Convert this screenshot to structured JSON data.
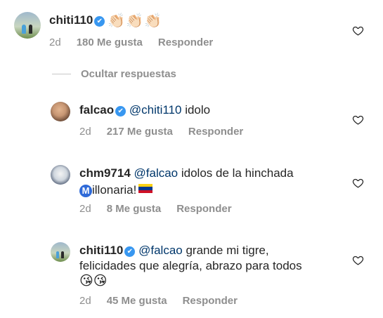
{
  "comments": [
    {
      "username": "chiti110",
      "text": "👏🏻👏🏻👏🏻",
      "age": "2d",
      "likes": "180 Me gusta",
      "reply": "Responder"
    },
    {
      "username": "falcao",
      "mention": "@chiti110",
      "text": " idolo",
      "age": "2d",
      "likes": "217 Me gusta",
      "reply": "Responder"
    },
    {
      "username": "chm9714",
      "mention": "@falcao",
      "text_line1": " idolos de la hinchada",
      "m_badge": "M",
      "text_line2": "illonaria!",
      "age": "2d",
      "likes": "8 Me gusta",
      "reply": "Responder"
    },
    {
      "username": "chiti110",
      "mention": "@falcao",
      "text_line1": " grande mi tigre,",
      "text_line2": "felicidades que alegría, abrazo para todos",
      "emojis": "😘😘",
      "age": "2d",
      "likes": "45 Me gusta",
      "reply": "Responder"
    }
  ],
  "hide_replies": "Ocultar respuestas",
  "verified_mark": "✔",
  "icons": {
    "like": "heart-outline-icon",
    "verified": "verified-badge-icon",
    "flag": "colombia-flag-icon"
  },
  "colors": {
    "verified": "#3897f0",
    "mention": "#00376b",
    "muted": "#8e8e8e"
  }
}
